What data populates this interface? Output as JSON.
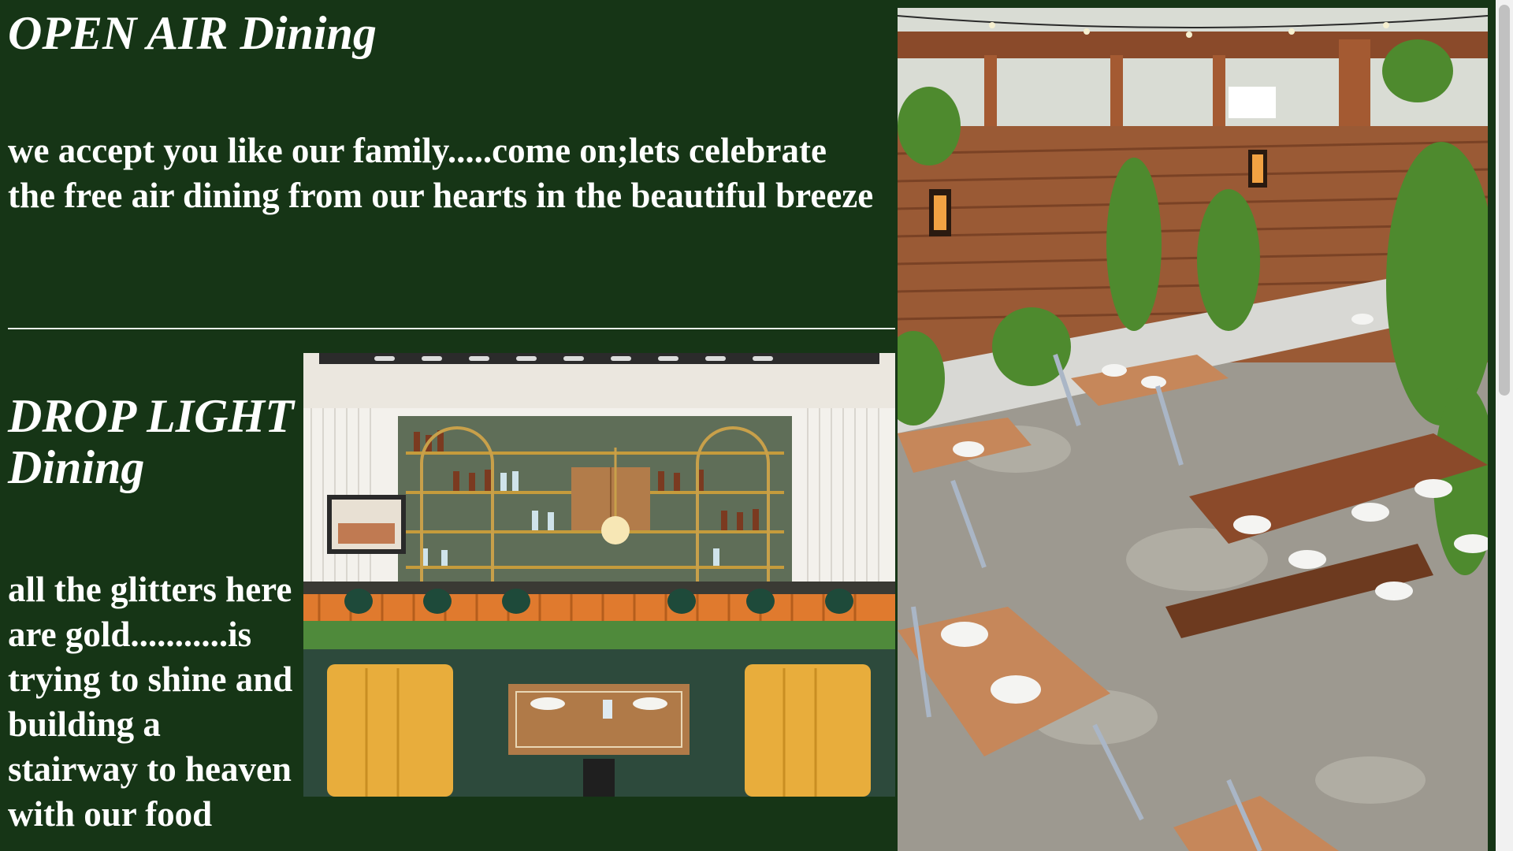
{
  "sections": [
    {
      "title": "OPEN AIR Dining",
      "description": "we accept you like our family.....come on;lets celebrate the free air dining from our hearts in the beautiful breeze"
    },
    {
      "title": "DROP LIGHT Dining",
      "description": "all the glitters here are gold...........is trying to shine and building a stairway to heaven with our food"
    }
  ],
  "images": {
    "bar_photo": "bar-interior-photo",
    "patio_photo": "outdoor-patio-photo"
  },
  "colors": {
    "background": "#163516",
    "text": "#ffffff",
    "divider": "#e9efe9"
  }
}
